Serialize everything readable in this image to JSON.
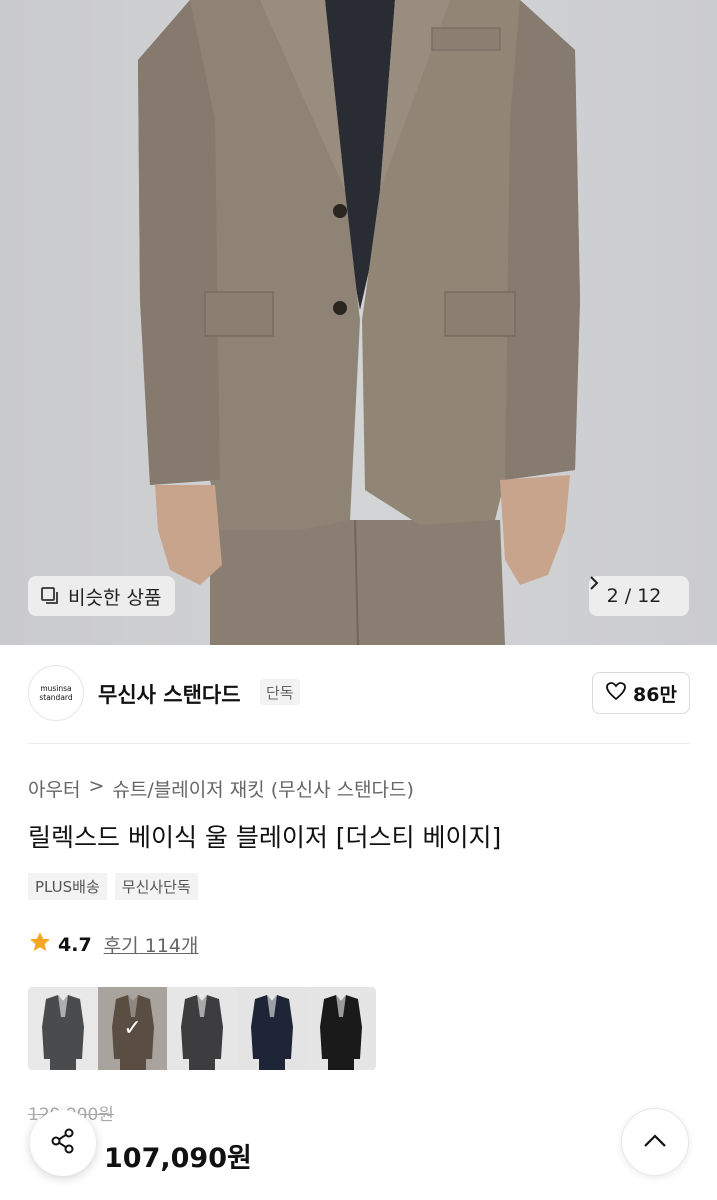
{
  "gallery": {
    "similar_label": "비슷한 상품",
    "counter": "2 / 12",
    "next_icon": "chevron-right-icon"
  },
  "brand": {
    "logo_line1": "musinsa",
    "logo_line2": "standard",
    "name": "무신사 스탠다드",
    "badge": "단독",
    "likes": "86만"
  },
  "product": {
    "breadcrumb": [
      "아우터",
      "슈트/블레이저 재킷 (무신사 스탠다드)"
    ],
    "breadcrumb_sep": ">",
    "title": "릴렉스드 베이식 울 블레이저 [더스티 베이지]",
    "tags": [
      "PLUS배송",
      "무신사단독"
    ],
    "rating": "4.7",
    "review_label": "후기 114개"
  },
  "colors": {
    "selected_index": 1,
    "swatches": [
      "#4a4b4d",
      "#6b5d4f",
      "#3d3d40",
      "#1e2537",
      "#1a1a1b"
    ]
  },
  "price": {
    "original": "129,900원",
    "discount": "",
    "sale": "107,090원"
  },
  "theme": {
    "accent_red": "#ff3b30",
    "star": "#f5a623"
  }
}
